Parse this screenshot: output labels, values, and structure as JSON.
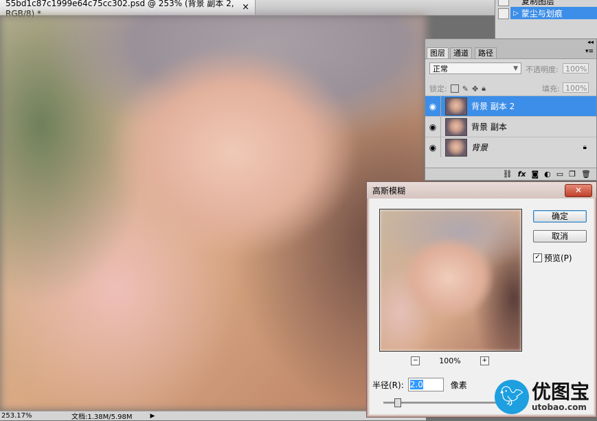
{
  "document": {
    "tab_title": "55bd1c87c1999e64c75cc302.psd @ 253% (背景 副本 2, RGB/8) *",
    "close_glyph": "×"
  },
  "status_bar": {
    "zoom": "253.17%",
    "doc_info": "文档:1.38M/5.98M"
  },
  "actions": {
    "items": [
      {
        "label": "复制图层",
        "selected": false
      },
      {
        "label": "蒙尘与划痕",
        "selected": true
      }
    ]
  },
  "layers_panel": {
    "tabs": [
      "图层",
      "通道",
      "路径"
    ],
    "blend_mode": "正常",
    "opacity_label": "不透明度:",
    "opacity_value": "100%",
    "lock_label": "锁定:",
    "fill_label": "填充:",
    "fill_value": "100%",
    "layers": [
      {
        "name": "背景 副本 2",
        "selected": true
      },
      {
        "name": "背景 副本",
        "selected": false
      },
      {
        "name": "背景",
        "selected": false,
        "locked": true
      }
    ]
  },
  "gaussian_blur_dialog": {
    "title": "高斯模糊",
    "ok_label": "确定",
    "cancel_label": "取消",
    "preview_label": "预览(P)",
    "preview_checked": true,
    "zoom_value": "100%",
    "radius_label": "半径(R):",
    "radius_value": "2.0",
    "radius_unit": "像素"
  },
  "watermark": {
    "title": "优图宝",
    "url": "utobao.com"
  }
}
